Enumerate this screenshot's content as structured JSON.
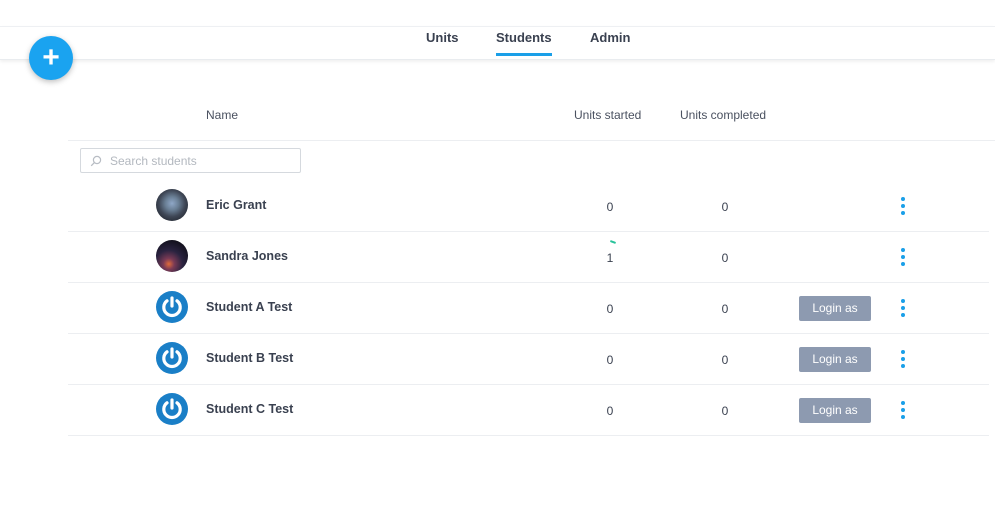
{
  "tabs": [
    {
      "label": "Units",
      "active": false
    },
    {
      "label": "Students",
      "active": true
    },
    {
      "label": "Admin",
      "active": false
    }
  ],
  "add_button": {
    "icon": "plus-icon",
    "label": "+"
  },
  "columns": {
    "name": "Name",
    "units_started": "Units started",
    "units_completed": "Units completed"
  },
  "search": {
    "placeholder": "Search students",
    "value": ""
  },
  "students": [
    {
      "name": "Eric Grant",
      "units_started": "0",
      "units_completed": "0",
      "avatar": "photo",
      "login_label": ""
    },
    {
      "name": "Sandra Jones",
      "units_started": "1",
      "units_completed": "0",
      "avatar": "photo",
      "login_label": ""
    },
    {
      "name": "Student A Test",
      "units_started": "0",
      "units_completed": "0",
      "avatar": "power-icon",
      "login_label": "Login as"
    },
    {
      "name": "Student B Test",
      "units_started": "0",
      "units_completed": "0",
      "avatar": "power-icon",
      "login_label": "Login as"
    },
    {
      "name": "Student C Test",
      "units_started": "0",
      "units_completed": "0",
      "avatar": "power-icon",
      "login_label": "Login as"
    }
  ],
  "colors": {
    "accent": "#1a9fe8",
    "login_button": "#8d9ab0",
    "avatar_default": "#1a7fc7"
  }
}
